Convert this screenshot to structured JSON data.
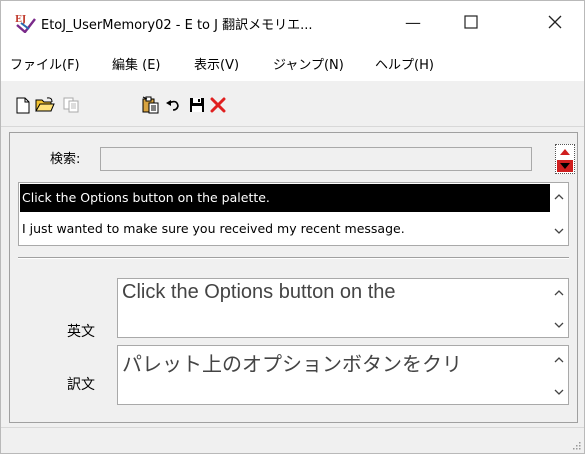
{
  "window": {
    "title": "EtoJ_UserMemory02 - E to J 翻訳メモリエ...",
    "minimize_glyph": "—",
    "maximize_glyph": "☐",
    "close_glyph": "✕"
  },
  "menu": [
    {
      "label": "ファイル(F)"
    },
    {
      "label": "編集 (E)"
    },
    {
      "label": "表示(V)"
    },
    {
      "label": "ジャンプ(N)"
    },
    {
      "label": "ヘルプ(H)"
    }
  ],
  "toolbar": {
    "icons": [
      "new-document-icon",
      "open-folder-icon",
      "copy-icon",
      "paste-icon",
      "undo-icon",
      "save-icon",
      "delete-icon"
    ]
  },
  "search": {
    "label": "検索:",
    "value": ""
  },
  "memo_list": {
    "items": [
      "Click the Options button on the palette.",
      "I just wanted to make sure you received my recent message."
    ],
    "selected_index": 0
  },
  "source": {
    "label": "英文",
    "text": "Click the Options button on the"
  },
  "translation": {
    "label": "訳文",
    "text": "パレット上のオプションボタンをクリ"
  },
  "colors": {
    "selection_bg": "#000000",
    "delete_red": "#e02020",
    "spin_down_red": "#d01f1f",
    "window_bg": "#f0f0f0"
  }
}
